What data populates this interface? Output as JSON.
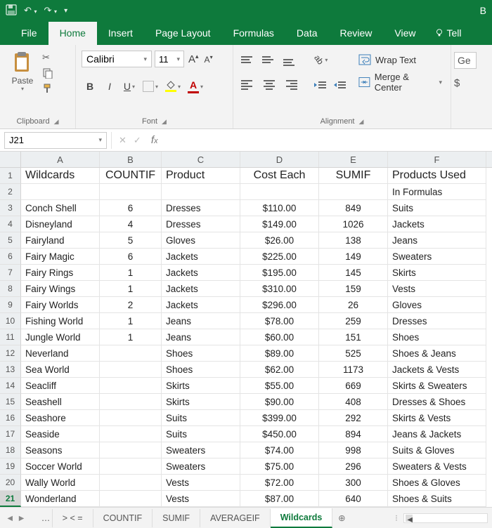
{
  "title_letter": "B",
  "tabs": {
    "file": "File",
    "home": "Home",
    "insert": "Insert",
    "layout": "Page Layout",
    "formulas": "Formulas",
    "data": "Data",
    "review": "Review",
    "view": "View",
    "tell": "Tell"
  },
  "ribbon": {
    "clipboard": {
      "paste": "Paste",
      "label": "Clipboard"
    },
    "font": {
      "name": "Calibri",
      "size": "11",
      "label": "Font"
    },
    "alignment": {
      "wrap": "Wrap Text",
      "merge": "Merge & Center",
      "label": "Alignment"
    },
    "number": {
      "hint1": "Ge",
      "hint2": "$"
    }
  },
  "namebox": "J21",
  "formula": "",
  "columns": [
    "A",
    "B",
    "C",
    "D",
    "E",
    "F"
  ],
  "headers": {
    "A": "Wildcards",
    "B": "COUNTIF",
    "C": "Product",
    "D": "Cost Each",
    "E": "SUMIF",
    "F": "Products Used"
  },
  "row2": {
    "F": "In Formulas"
  },
  "data": [
    {
      "r": 3,
      "A": "Conch Shell",
      "B": "6",
      "C": "Dresses",
      "D": "$110.00",
      "E": "849",
      "F": "Suits"
    },
    {
      "r": 4,
      "A": "Disneyland",
      "B": "4",
      "C": "Dresses",
      "D": "$149.00",
      "E": "1026",
      "F": "Jackets"
    },
    {
      "r": 5,
      "A": "Fairyland",
      "B": "5",
      "C": "Gloves",
      "D": "$26.00",
      "E": "138",
      "F": "Jeans"
    },
    {
      "r": 6,
      "A": "Fairy Magic",
      "B": "6",
      "C": "Jackets",
      "D": "$225.00",
      "E": "149",
      "F": "Sweaters"
    },
    {
      "r": 7,
      "A": "Fairy Rings",
      "B": "1",
      "C": "Jackets",
      "D": "$195.00",
      "E": "145",
      "F": "Skirts"
    },
    {
      "r": 8,
      "A": "Fairy Wings",
      "B": "1",
      "C": "Jackets",
      "D": "$310.00",
      "E": "159",
      "F": "Vests"
    },
    {
      "r": 9,
      "A": "Fairy Worlds",
      "B": "2",
      "C": "Jackets",
      "D": "$296.00",
      "E": "26",
      "F": "Gloves"
    },
    {
      "r": 10,
      "A": "Fishing World",
      "B": "1",
      "C": "Jeans",
      "D": "$78.00",
      "E": "259",
      "F": "Dresses"
    },
    {
      "r": 11,
      "A": "Jungle World",
      "B": "1",
      "C": "Jeans",
      "D": "$60.00",
      "E": "151",
      "F": "Shoes"
    },
    {
      "r": 12,
      "A": "Neverland",
      "B": "",
      "C": "Shoes",
      "D": "$89.00",
      "E": "525",
      "F": "Shoes & Jeans"
    },
    {
      "r": 13,
      "A": "Sea World",
      "B": "",
      "C": "Shoes",
      "D": "$62.00",
      "E": "1173",
      "F": "Jackets & Vests"
    },
    {
      "r": 14,
      "A": "Seacliff",
      "B": "",
      "C": "Skirts",
      "D": "$55.00",
      "E": "669",
      "F": "Skirts & Sweaters"
    },
    {
      "r": 15,
      "A": "Seashell",
      "B": "",
      "C": "Skirts",
      "D": "$90.00",
      "E": "408",
      "F": "Dresses & Shoes"
    },
    {
      "r": 16,
      "A": "Seashore",
      "B": "",
      "C": "Suits",
      "D": "$399.00",
      "E": "292",
      "F": "Skirts & Vests"
    },
    {
      "r": 17,
      "A": "Seaside",
      "B": "",
      "C": "Suits",
      "D": "$450.00",
      "E": "894",
      "F": "Jeans & Jackets"
    },
    {
      "r": 18,
      "A": "Seasons",
      "B": "",
      "C": "Sweaters",
      "D": "$74.00",
      "E": "998",
      "F": "Suits & Gloves"
    },
    {
      "r": 19,
      "A": "Soccer World",
      "B": "",
      "C": "Sweaters",
      "D": "$75.00",
      "E": "296",
      "F": "Sweaters & Vests"
    },
    {
      "r": 20,
      "A": "Wally World",
      "B": "",
      "C": "Vests",
      "D": "$72.00",
      "E": "300",
      "F": "Shoes & Gloves"
    },
    {
      "r": 21,
      "A": "Wonderland",
      "B": "",
      "C": "Vests",
      "D": "$87.00",
      "E": "640",
      "F": "Shoes & Suits"
    }
  ],
  "sheets": {
    "ellipsis": "…",
    "nav": "> < =",
    "s1": "COUNTIF",
    "s2": "SUMIF",
    "s3": "AVERAGEIF",
    "s4": "Wildcards"
  }
}
